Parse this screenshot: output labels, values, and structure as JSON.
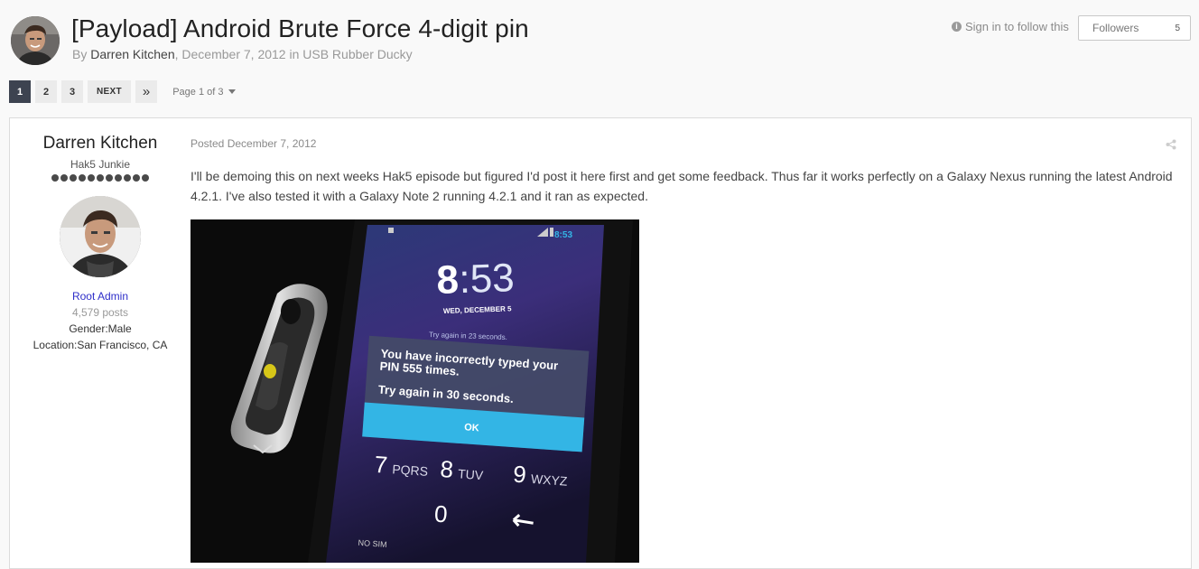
{
  "header": {
    "title": "[Payload] Android Brute Force 4-digit pin",
    "by_prefix": "By",
    "author": "Darren Kitchen",
    "meta_rest": ", December 7, 2012 in USB Rubber Ducky",
    "follow_label": "Sign in to follow this",
    "followers_label": "Followers",
    "followers_count": "5"
  },
  "pagination": {
    "pages": [
      "1",
      "2",
      "3"
    ],
    "next_label": "NEXT",
    "last_label": "»",
    "page_jump": "Page 1 of 3"
  },
  "post": {
    "author": {
      "name": "Darren Kitchen",
      "rank": "Hak5 Junkie",
      "pips": 11,
      "group": "Root Admin",
      "posts": "4,579 posts",
      "gender": "Gender:Male",
      "location": "Location:San Francisco, CA"
    },
    "date": "Posted December 7, 2012",
    "text": "I'll be demoing this on next weeks Hak5 episode but figured I'd post it here first and get some feedback. Thus far it works perfectly on a Galaxy Nexus running the latest Android 4.2.1. I've also tested it with a Galaxy Note 2 running 4.2.1 and it ran as expected.",
    "image": {
      "status_time": "8:53",
      "clock_hour": "8",
      "clock_min": ":53",
      "date": "WED, DECEMBER 5",
      "try_again_small": "Try again in 23 seconds.",
      "dialog_line1": "You have incorrectly typed your",
      "dialog_line2": "PIN 555 times.",
      "dialog_line3": "Try again in 30 seconds.",
      "ok_label": "OK",
      "keys": [
        {
          "digit": "7",
          "letters": "PQRS"
        },
        {
          "digit": "8",
          "letters": "TUV"
        },
        {
          "digit": "9",
          "letters": "WXYZ"
        },
        {
          "digit": "0",
          "letters": ""
        }
      ],
      "no_sim": "NO SIM"
    }
  },
  "colors": {
    "accent_dark": "#3d4350",
    "group_blue": "#2e2ec9",
    "dialog_ok": "#33b5e5"
  }
}
